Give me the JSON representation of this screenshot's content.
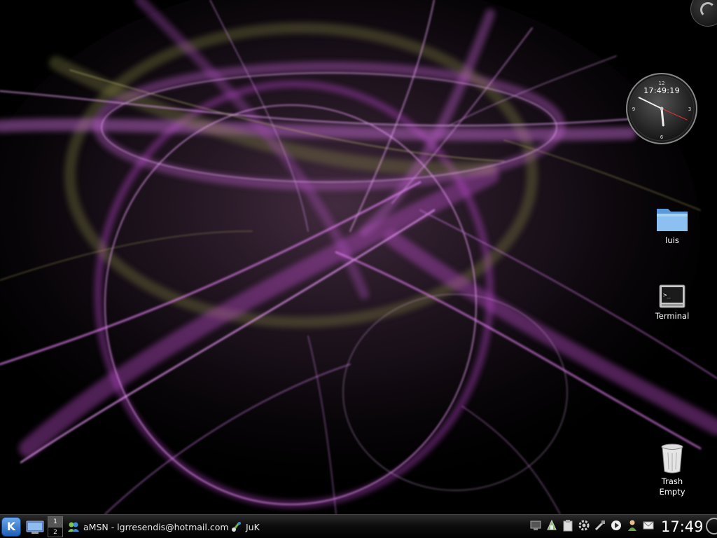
{
  "desktop": {
    "clock_widget": {
      "time": "17:49:19",
      "hands": {
        "hour": 17,
        "minute": 49,
        "second": 19
      }
    },
    "icons": [
      {
        "label": "luis",
        "icon": "folder-icon"
      },
      {
        "label": "Terminal",
        "icon": "terminal-icon"
      },
      {
        "label": "Trash\nEmpty",
        "icon": "trash-icon"
      }
    ]
  },
  "panel": {
    "kmenu_label": "K",
    "pager": [
      "1",
      "2"
    ],
    "tasks": [
      {
        "label": "aMSN - lgrresendis@hotmail.com",
        "icon": "amsn-icon"
      },
      {
        "label": "JuK",
        "icon": "juk-icon"
      }
    ],
    "tray": [
      "network-icon",
      "klipper-icon",
      "clipboard-icon",
      "settings-icon",
      "usb-icon",
      "media-play-icon",
      "user-icon",
      "mail-icon"
    ],
    "clock": "17:49"
  },
  "colors": {
    "accent": "#cc55dd",
    "secondary": "#9a9a55",
    "panel_bg": "#0d0d0d"
  }
}
